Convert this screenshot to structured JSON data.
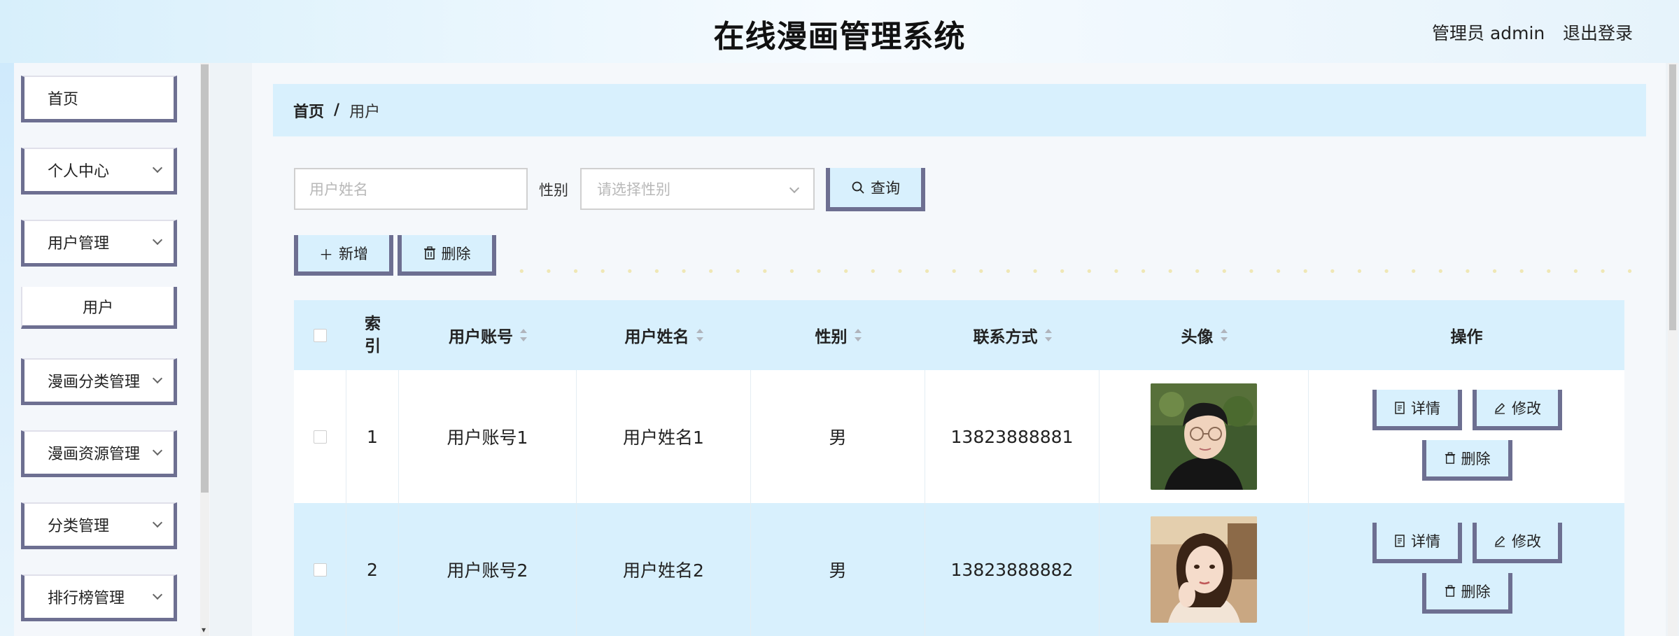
{
  "header": {
    "title": "在线漫画管理系统",
    "admin": "管理员 admin",
    "logout": "退出登录"
  },
  "sidebar": {
    "items": [
      {
        "label": "首页",
        "has_chevron": false
      },
      {
        "label": "个人中心",
        "has_chevron": true
      },
      {
        "label": "用户管理",
        "has_chevron": true
      },
      {
        "label": "漫画分类管理",
        "has_chevron": true
      },
      {
        "label": "漫画资源管理",
        "has_chevron": true
      },
      {
        "label": "分类管理",
        "has_chevron": true
      },
      {
        "label": "排行榜管理",
        "has_chevron": true
      }
    ],
    "sub_item": "用户"
  },
  "breadcrumb": {
    "home": "首页",
    "separator": "/",
    "current": "用户"
  },
  "search": {
    "name_placeholder": "用户姓名",
    "gender_label": "性别",
    "gender_placeholder": "请选择性别",
    "query_button": "查询"
  },
  "actions": {
    "add": "新增",
    "delete": "删除"
  },
  "table": {
    "headers": {
      "index": "索\n引",
      "account": "用户账号",
      "name": "用户姓名",
      "gender": "性别",
      "contact": "联系方式",
      "avatar": "头像",
      "ops": "操作"
    },
    "rows": [
      {
        "index": "1",
        "account": "用户账号1",
        "name": "用户姓名1",
        "gender": "男",
        "contact": "13823888881"
      },
      {
        "index": "2",
        "account": "用户账号2",
        "name": "用户姓名2",
        "gender": "男",
        "contact": "13823888882"
      }
    ],
    "op_labels": {
      "detail": "详情",
      "edit": "修改",
      "delete": "删除"
    }
  },
  "colors": {
    "accent_border": "#6d6f91",
    "light_blue": "#d8f0fd"
  }
}
